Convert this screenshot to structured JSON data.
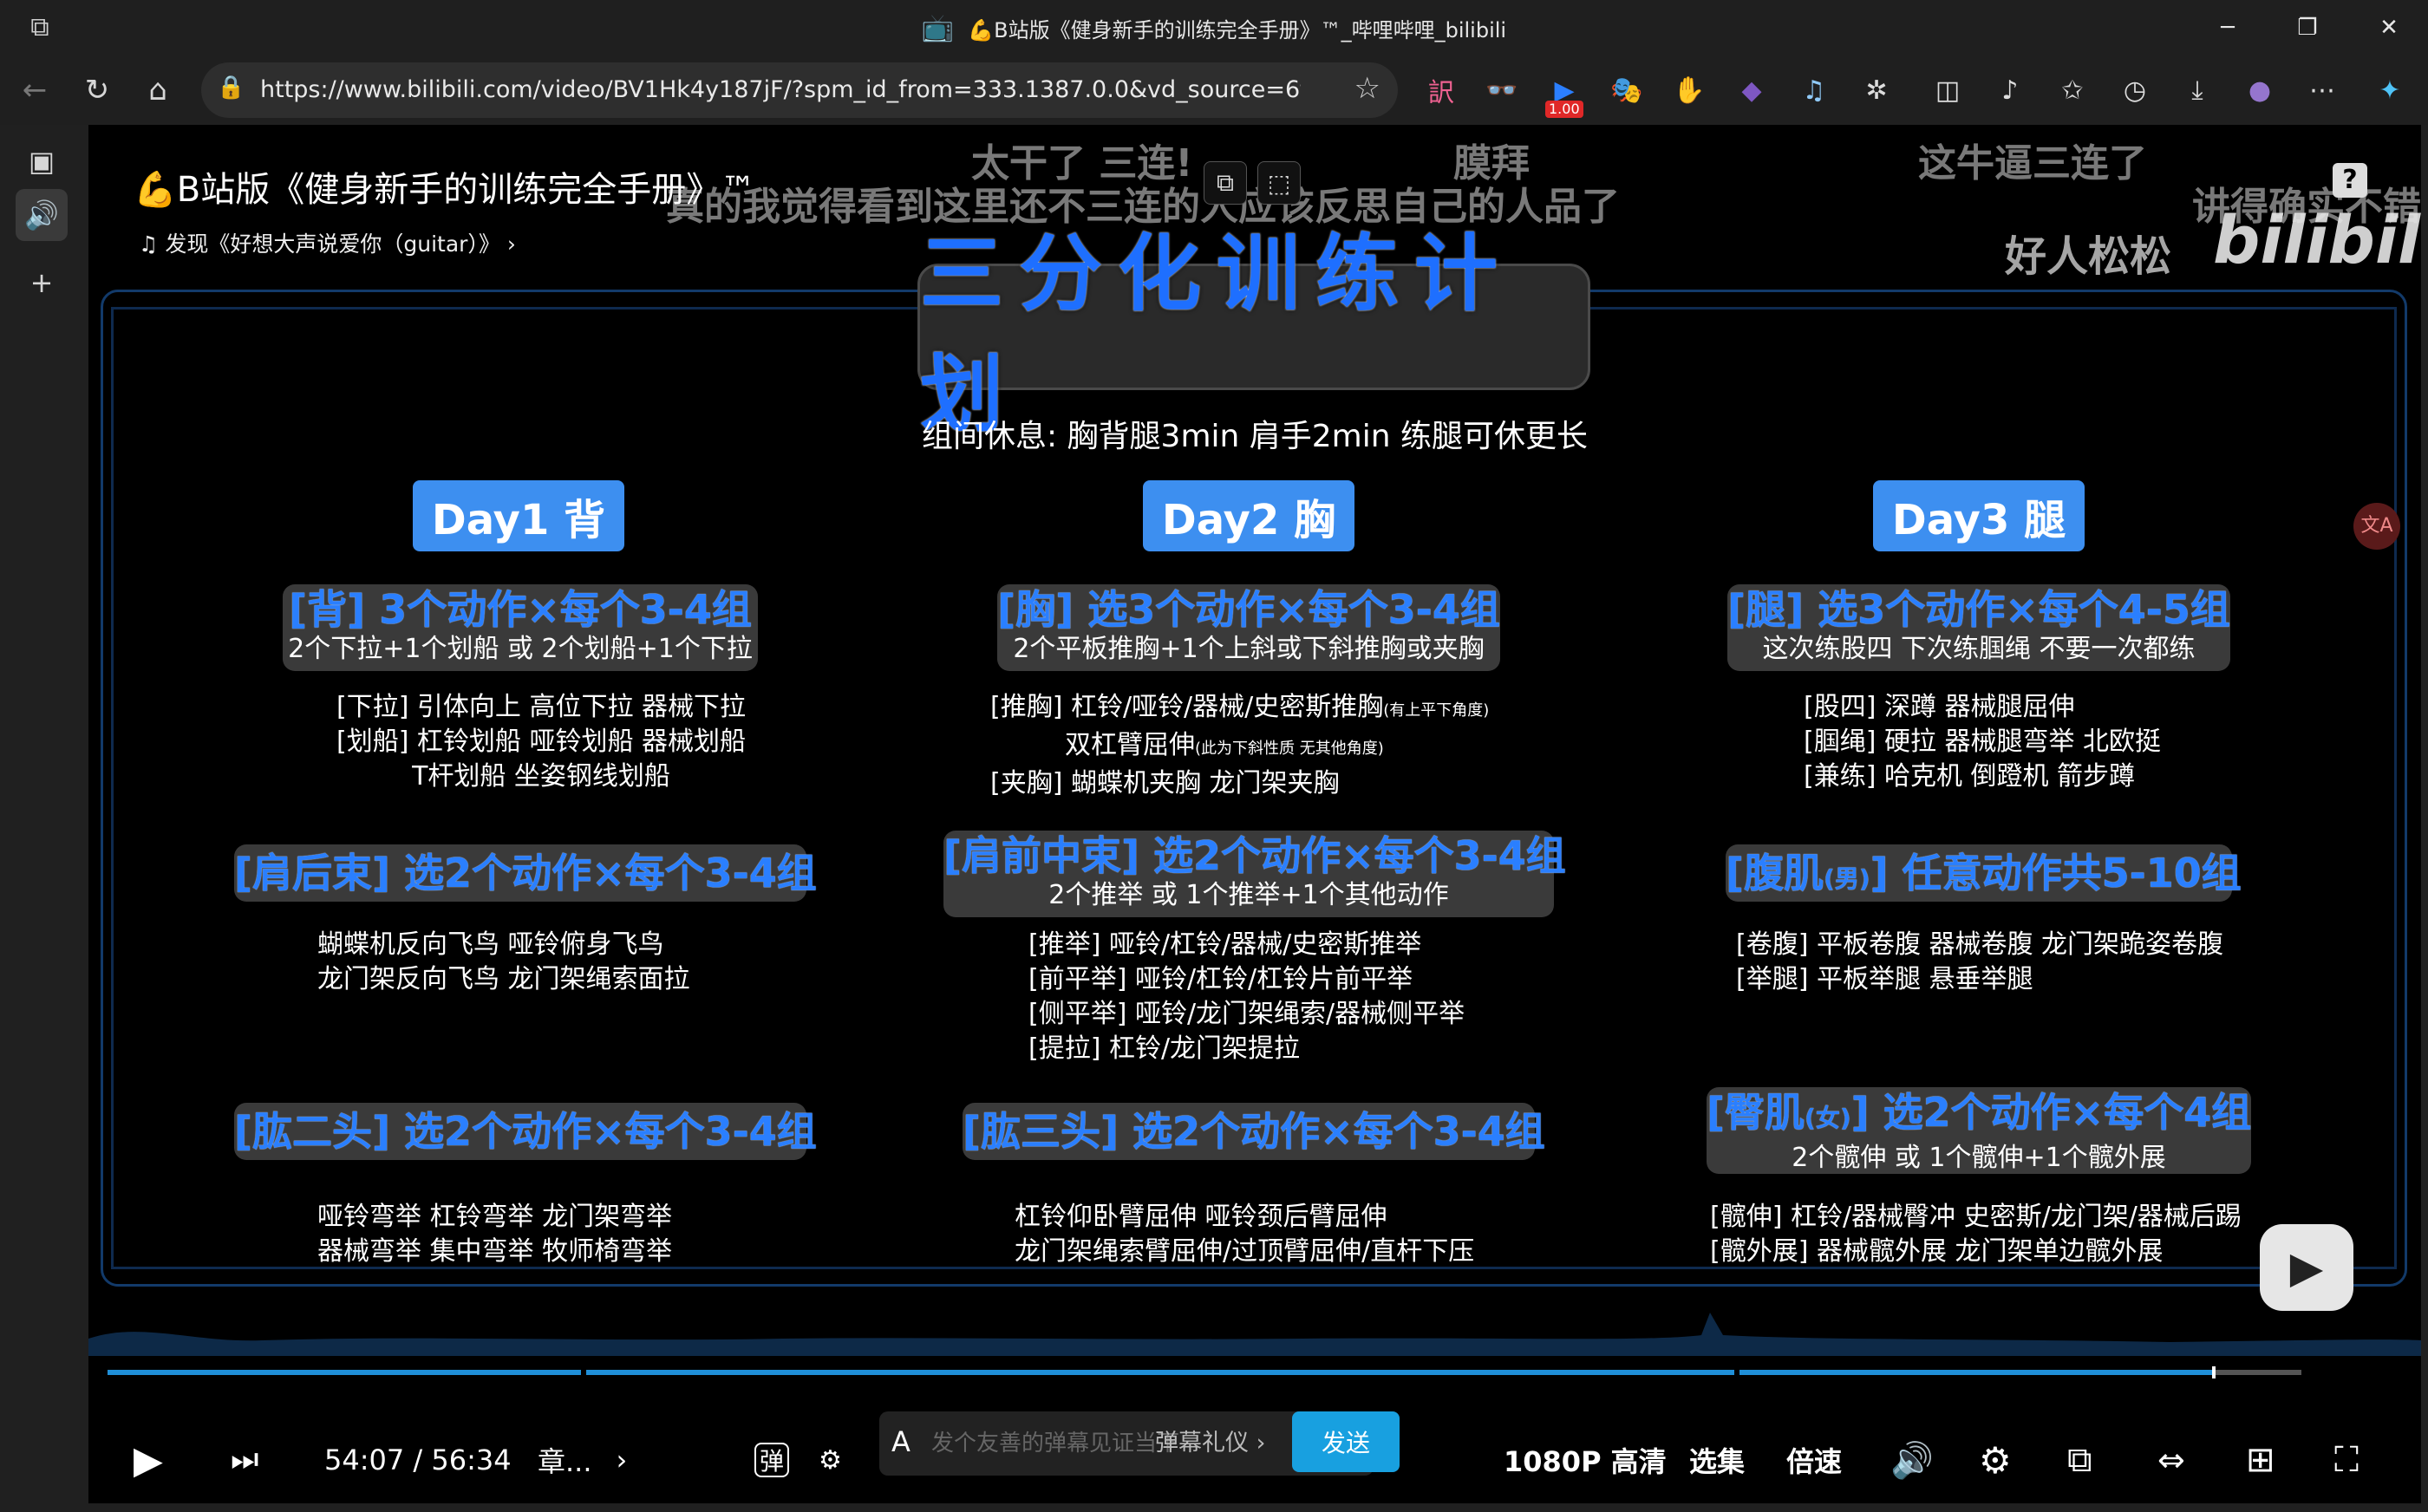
{
  "window": {
    "title": "💪B站版《健身新手的训练完全手册》™_哔哩哔哩_bilibili",
    "minimize": "─",
    "maximize": "❐",
    "close": "✕"
  },
  "browser": {
    "url": "https://www.bilibili.com/video/BV1Hk4y187jF/?spm_id_from=333.1387.0.0&vd_source=6fee5888cf...",
    "ext_badge": "1.00"
  },
  "video": {
    "title": "💪B站版《健身新手的训练完全手册》™",
    "music": "发现《好想大声说爱你（guitar）》",
    "logo": "bilibili",
    "danmaku": [
      "太干了 三连!",
      "膜拜",
      "这牛逼三连了",
      "真的我觉得看到这里还不三连的人应该反思自己的人品了",
      "讲得确实不错",
      "好人松松"
    ],
    "question_mark": "?",
    "translate": "文A"
  },
  "plan": {
    "title": "三分化训练计划",
    "rest": "组间休息: 胸背腿3min 肩手2min 练腿可休更长",
    "days": [
      "Day1 背",
      "Day2 胸",
      "Day3 腿"
    ],
    "back": {
      "h": "[背] 3个动作×每个3-4组",
      "s": "2个下拉+1个划船 或 2个划船+1个下拉",
      "l1": "[下拉] 引体向上 高位下拉 器械下拉",
      "l2": "[划船] 杠铃划船 哑铃划船 器械划船",
      "l3": "T杆划船 坐姿钢线划船"
    },
    "rear_delt": {
      "h": "[肩后束] 选2个动作×每个3-4组",
      "l1": "蝴蝶机反向飞鸟 哑铃俯身飞鸟",
      "l2": "龙门架反向飞鸟 龙门架绳索面拉"
    },
    "biceps": {
      "h": "[肱二头] 选2个动作×每个3-4组",
      "l1": "哑铃弯举 杠铃弯举 龙门架弯举",
      "l2": "器械弯举 集中弯举 牧师椅弯举"
    },
    "chest": {
      "h": "[胸] 选3个动作×每个3-4组",
      "s": "2个平板推胸+1个上斜或下斜推胸或夹胸",
      "l1": "[推胸] 杠铃/哑铃/器械/史密斯推胸",
      "l1n": "(有上平下角度)",
      "l2": "双杠臂屈伸",
      "l2n": "(此为下斜性质 无其他角度)",
      "l3": "[夹胸] 蝴蝶机夹胸 龙门架夹胸"
    },
    "front_delt": {
      "h": "[肩前中束] 选2个动作×每个3-4组",
      "s": "2个推举 或 1个推举+1个其他动作",
      "l1": "[推举] 哑铃/杠铃/器械/史密斯推举",
      "l2": "[前平举] 哑铃/杠铃/杠铃片前平举",
      "l3": "[侧平举] 哑铃/龙门架绳索/器械侧平举",
      "l4": "[提拉] 杠铃/龙门架提拉"
    },
    "triceps": {
      "h": "[肱三头] 选2个动作×每个3-4组",
      "l1": "杠铃仰卧臂屈伸 哑铃颈后臂屈伸",
      "l2": "龙门架绳索臂屈伸/过顶臂屈伸/直杆下压"
    },
    "legs": {
      "h": "[腿] 选3个动作×每个4-5组",
      "s": "这次练股四 下次练腘绳 不要一次都练",
      "l1": "[股四] 深蹲 器械腿屈伸",
      "l2": "[腘绳] 硬拉 器械腿弯举 北欧挺",
      "l3": "[兼练] 哈克机 倒蹬机 箭步蹲"
    },
    "abs": {
      "h1": "[腹肌",
      "hs": "(男)",
      "h2": "] 任意动作共5-10组",
      "l1": "[卷腹] 平板卷腹 器械卷腹 龙门架跪姿卷腹",
      "l2": "[举腿] 平板举腿 悬垂举腿"
    },
    "glutes": {
      "h1": "[臀肌",
      "hs": "(女)",
      "h2": "] 选2个动作×每个4组",
      "s": "2个髋伸 或 1个髋伸+1个髋外展",
      "l1": "[髋伸] 杠铃/器械臀冲 史密斯/龙门架/器械后踢",
      "l2": "[髋外展] 器械髋外展 龙门架单边髋外展"
    }
  },
  "player": {
    "progress": 0.961,
    "time": "54:07",
    "sep": "/",
    "duration": "56:34",
    "chapter": "章...",
    "danmaku_placeholder": "发个友善的弹幕见证当下",
    "danmaku_etiquette": "弹幕礼仪 ›",
    "send": "发送",
    "quality": "1080P 高清",
    "episodes": "选集",
    "speed": "倍速",
    "dan_label": "弹"
  }
}
